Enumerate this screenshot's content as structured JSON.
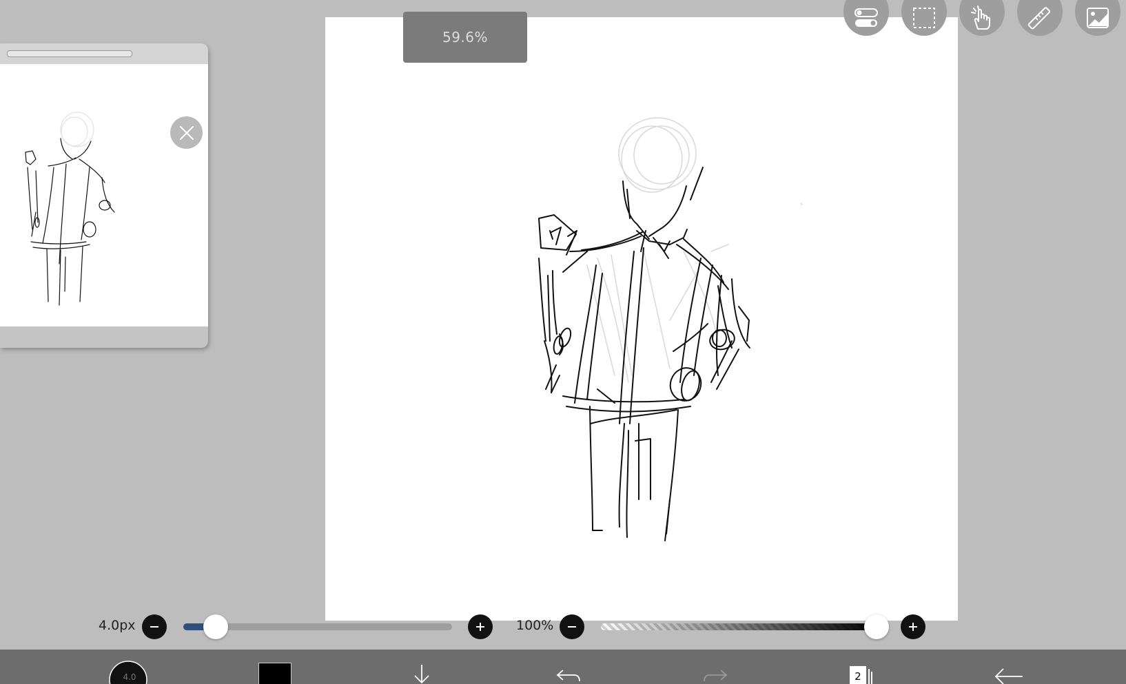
{
  "canvas": {
    "zoom_label": "59.6%"
  },
  "top_tools": [
    {
      "name": "layer-settings-icon"
    },
    {
      "name": "selection-icon"
    },
    {
      "name": "hand-tool-icon"
    },
    {
      "name": "ruler-icon"
    },
    {
      "name": "material-icon"
    }
  ],
  "brush": {
    "size_label": "4.0px",
    "size_fraction": 0.12,
    "opacity_label": "100%",
    "opacity_fraction": 1.0
  },
  "toolbar": {
    "layers_count": "2",
    "brush_badge": "4.0",
    "current_color": "#000000"
  },
  "colors": {
    "background": "#bdbdbd",
    "toolbar": "#6d6d6d",
    "size_fill": "#2f4f7a"
  }
}
